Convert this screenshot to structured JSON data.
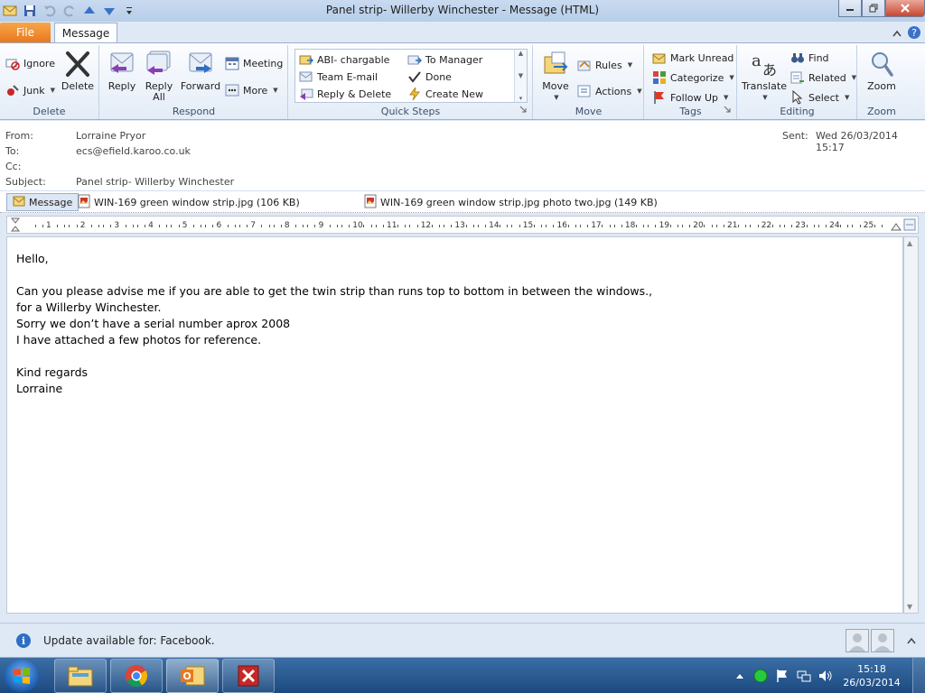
{
  "window": {
    "title": "Panel strip- Willerby Winchester  -  Message (HTML)"
  },
  "tabs": {
    "file": "File",
    "message": "Message"
  },
  "ribbon": {
    "delete_group": {
      "label": "Delete",
      "ignore": "Ignore",
      "junk": "Junk",
      "delete": "Delete"
    },
    "respond_group": {
      "label": "Respond",
      "reply": "Reply",
      "reply_all_1": "Reply",
      "reply_all_2": "All",
      "forward": "Forward",
      "meeting": "Meeting",
      "more": "More"
    },
    "quick_steps": {
      "label": "Quick Steps",
      "items": [
        "ABI- chargable",
        "Team E-mail",
        "Reply & Delete",
        "To Manager",
        "Done",
        "Create New"
      ]
    },
    "move_group": {
      "label": "Move",
      "move": "Move",
      "rules": "Rules",
      "actions": "Actions"
    },
    "tags_group": {
      "label": "Tags",
      "mark_unread": "Mark Unread",
      "categorize": "Categorize",
      "follow_up": "Follow Up"
    },
    "editing_group": {
      "label": "Editing",
      "translate": "Translate",
      "find": "Find",
      "related": "Related",
      "select": "Select"
    },
    "zoom_group": {
      "label": "Zoom",
      "zoom": "Zoom"
    }
  },
  "header": {
    "from_label": "From:",
    "from": "Lorraine Pryor",
    "to_label": "To:",
    "to": "ecs@efield.karoo.co.uk",
    "cc_label": "Cc:",
    "cc": "",
    "subject_label": "Subject:",
    "subject": "Panel strip- Willerby Winchester",
    "sent_label": "Sent:",
    "sent": "Wed 26/03/2014 15:17"
  },
  "attachments": {
    "message_tab": "Message",
    "files": [
      "WIN-169 green window strip.jpg (106 KB)",
      "WIN-169 green window strip.jpg photo two.jpg (149 KB)"
    ]
  },
  "ruler": {
    "numbers": [
      "1",
      "2",
      "3",
      "4",
      "5",
      "6",
      "7",
      "8",
      "9",
      "10",
      "11",
      "12",
      "13",
      "14",
      "15",
      "16",
      "17",
      "18",
      "19",
      "20",
      "21",
      "22",
      "23",
      "24",
      "25"
    ]
  },
  "body": {
    "lines": [
      "Hello,",
      "",
      "Can you please advise me if you are able to get the  twin strip than runs top to bottom in between the windows.,",
      "for a Willerby Winchester.",
      "Sorry we don’t have a serial number aprox 2008",
      "I have attached a few photos for reference.",
      "",
      "Kind regards",
      "Lorraine"
    ]
  },
  "infobar": {
    "text": "Update available for: Facebook.",
    "icon": "i"
  },
  "taskbar": {
    "time": "15:18",
    "date": "26/03/2014"
  },
  "colors": {
    "file_tab": "#e9781e",
    "ribbon_bg": "#e3ecf7",
    "taskbar": "#2a5a90",
    "info_icon": "#2c6fc3"
  }
}
